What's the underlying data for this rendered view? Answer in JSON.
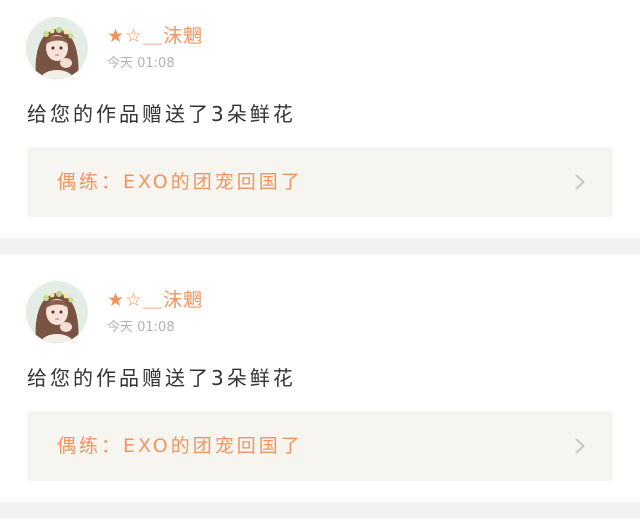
{
  "notifications": [
    {
      "avatar_icon": "user-avatar",
      "username": "★☆＿沫魍",
      "time": "今天 01:08",
      "message": "给您的作品赠送了3朵鲜花",
      "work_title": "偶练：EXO的团宠回国了",
      "chevron_icon": "chevron-right-icon"
    },
    {
      "avatar_icon": "user-avatar",
      "username": "★☆＿沫魍",
      "time": "今天 01:08",
      "message": "给您的作品赠送了3朵鲜花",
      "work_title": "偶练：EXO的团宠回国了",
      "chevron_icon": "chevron-right-icon"
    }
  ],
  "colors": {
    "accent": "#f0955e",
    "link_background": "#f6f5f0",
    "separator": "#f2f2f2",
    "secondary_text": "#b3b3b3",
    "body_text": "#333333"
  }
}
